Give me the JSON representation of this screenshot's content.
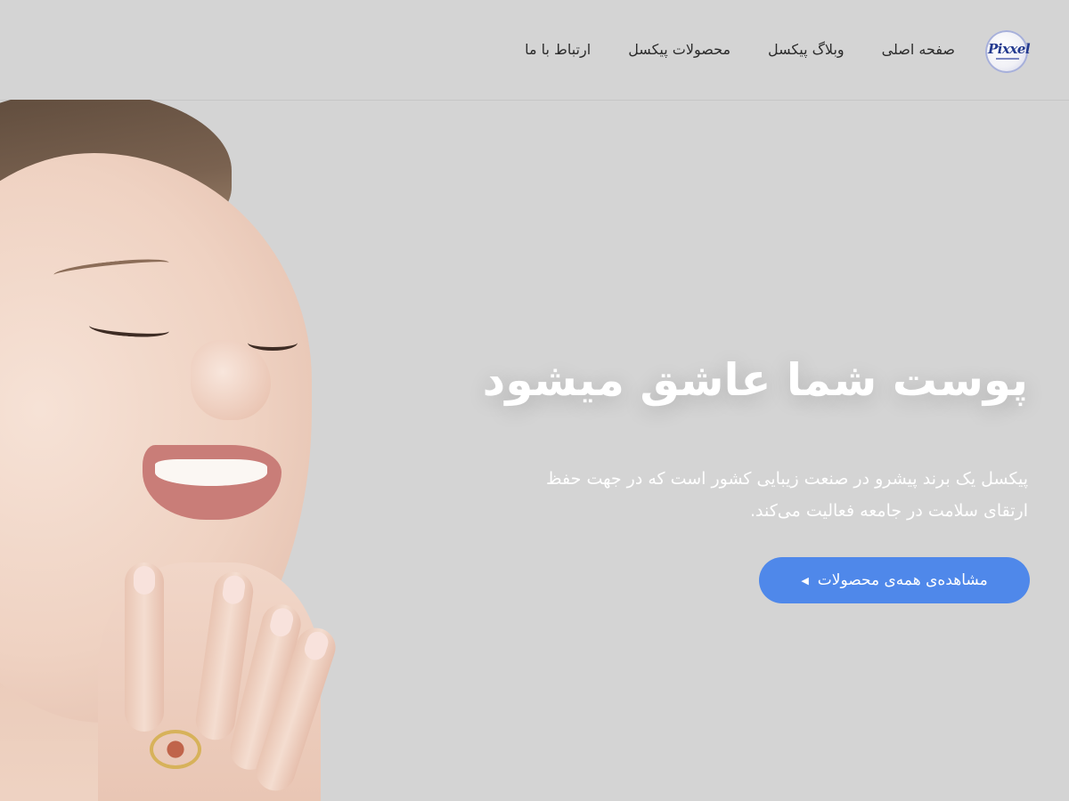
{
  "logo": {
    "text": "Pixxel"
  },
  "nav": {
    "items": [
      {
        "label": "صفحه اصلی"
      },
      {
        "label": "وبلاگ پیکسل"
      },
      {
        "label": "محصولات پیکسل"
      },
      {
        "label": "ارتباط با ما"
      }
    ]
  },
  "hero": {
    "title": "پوست شما عاشق میشود",
    "description": "پیکسل یک برند پیشرو در صنعت زیبایی کشور است که در جهت حفظ ارتقای سلامت در جامعه فعالیت می‌کند.",
    "cta_label": "مشاهده‌ی همه‌ی محصولات",
    "cta_icon": "arrow-left-icon"
  },
  "colors": {
    "background": "#d4d4d4",
    "accent": "#4f88ea",
    "hero_text": "#ffffff",
    "nav_text": "#2b2b2b"
  }
}
